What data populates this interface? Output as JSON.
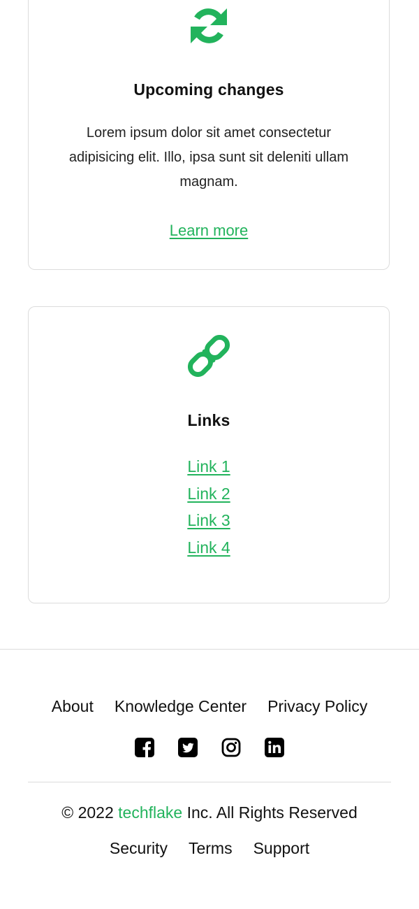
{
  "colors": {
    "accent": "#22b35c",
    "border": "#dcdcdc",
    "text": "#111111"
  },
  "upcoming": {
    "icon": "refresh-icon",
    "title": "Upcoming changes",
    "body": "Lorem ipsum dolor sit amet consectetur adipisicing elit. Illo, ipsa sunt sit deleniti ullam magnam.",
    "link": "Learn more"
  },
  "links_card": {
    "icon": "link-icon",
    "title": "Links",
    "items": [
      "Link 1",
      "Link 2",
      "Link 3",
      "Link 4"
    ]
  },
  "footer": {
    "nav": [
      "About",
      "Knowledge Center",
      "Privacy Policy"
    ],
    "social": [
      "facebook-icon",
      "twitter-icon",
      "instagram-icon",
      "linkedin-icon"
    ],
    "copyright_prefix": "© 2022",
    "brand": "techflake",
    "copyright_suffix": "Inc. All Rights Reserved",
    "legal": [
      "Security",
      "Terms",
      "Support"
    ]
  }
}
